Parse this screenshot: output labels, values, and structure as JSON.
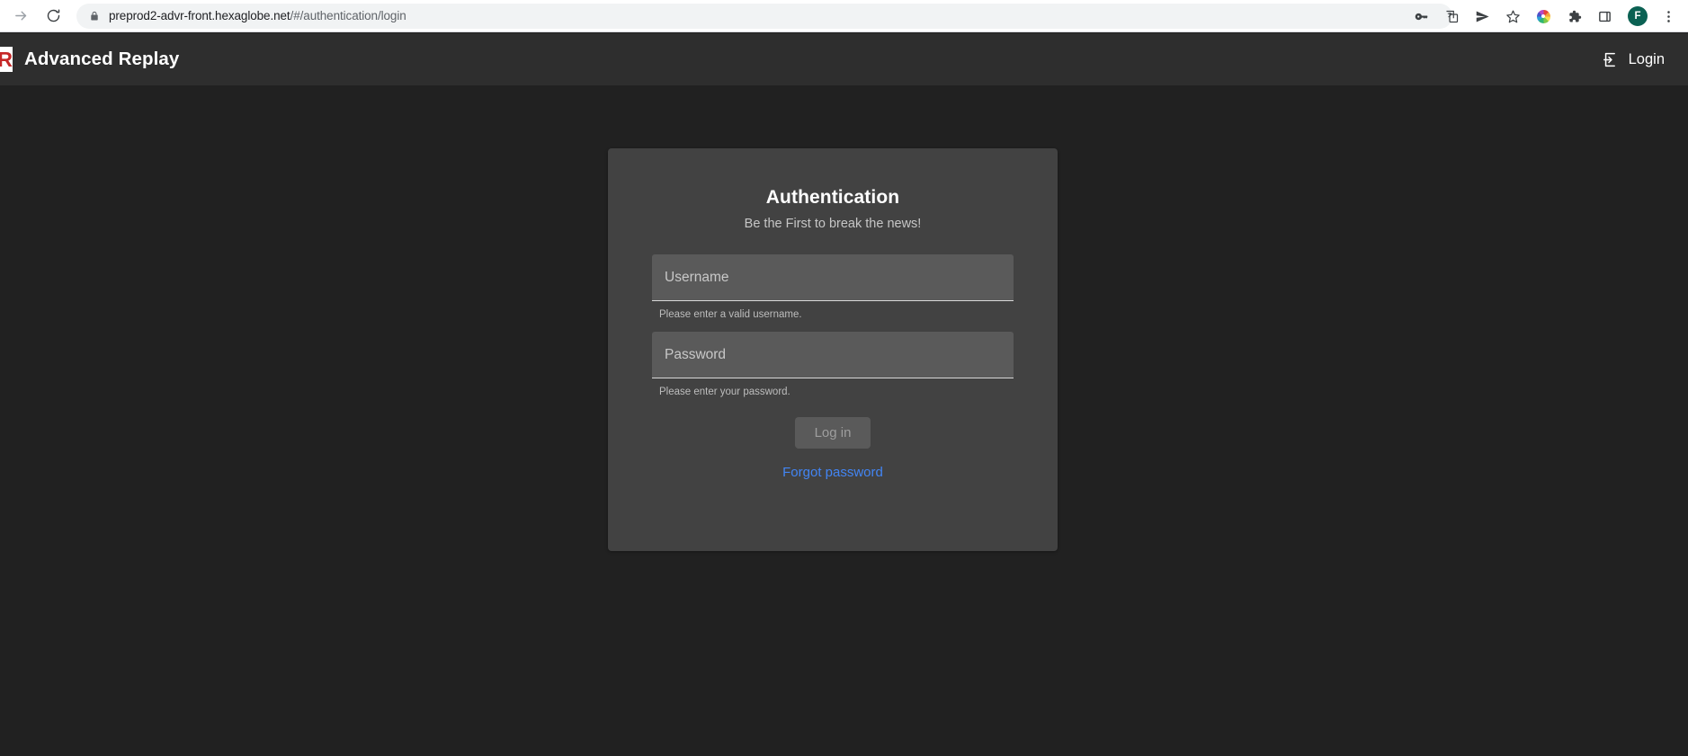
{
  "browser": {
    "url_host": "preprod2-advr-front.hexaglobe.net",
    "url_path": "/#/authentication/login",
    "nav": {
      "forward_icon": "arrow-forward-icon",
      "reload_icon": "reload-icon",
      "lock_icon": "lock-icon"
    },
    "toolbar_icons": [
      {
        "name": "password-key-icon",
        "glyph": "key"
      },
      {
        "name": "translate-icon",
        "glyph": "translate"
      },
      {
        "name": "send-share-icon",
        "glyph": "send"
      },
      {
        "name": "bookmark-star-icon",
        "glyph": "star"
      },
      {
        "name": "color-wheel-extension-icon",
        "glyph": "color-wheel"
      },
      {
        "name": "extensions-puzzle-icon",
        "glyph": "puzzle"
      },
      {
        "name": "side-panel-icon",
        "glyph": "square"
      }
    ],
    "profile_initial": "F",
    "menu_icon": "three-dot-menu-icon"
  },
  "app_header": {
    "logo_letter": "R",
    "title": "Advanced Replay",
    "login_label": "Login",
    "login_icon": "login-arrow-icon"
  },
  "auth_card": {
    "title": "Authentication",
    "subtitle": "Be the First to break the news!",
    "username": {
      "label": "Username",
      "placeholder": "Username",
      "value": "",
      "hint": "Please enter a valid username."
    },
    "password": {
      "label": "Password",
      "placeholder": "Password",
      "value": "",
      "hint": "Please enter your password."
    },
    "submit_label": "Log in",
    "forgot_label": "Forgot password"
  },
  "colors": {
    "page_background": "#212121",
    "card_background": "#424242",
    "header_background": "#2e2e2e",
    "input_background": "#5a5a5a",
    "link_blue": "#4285f4",
    "logo_red": "#c62828",
    "avatar_green": "#0b6153"
  }
}
